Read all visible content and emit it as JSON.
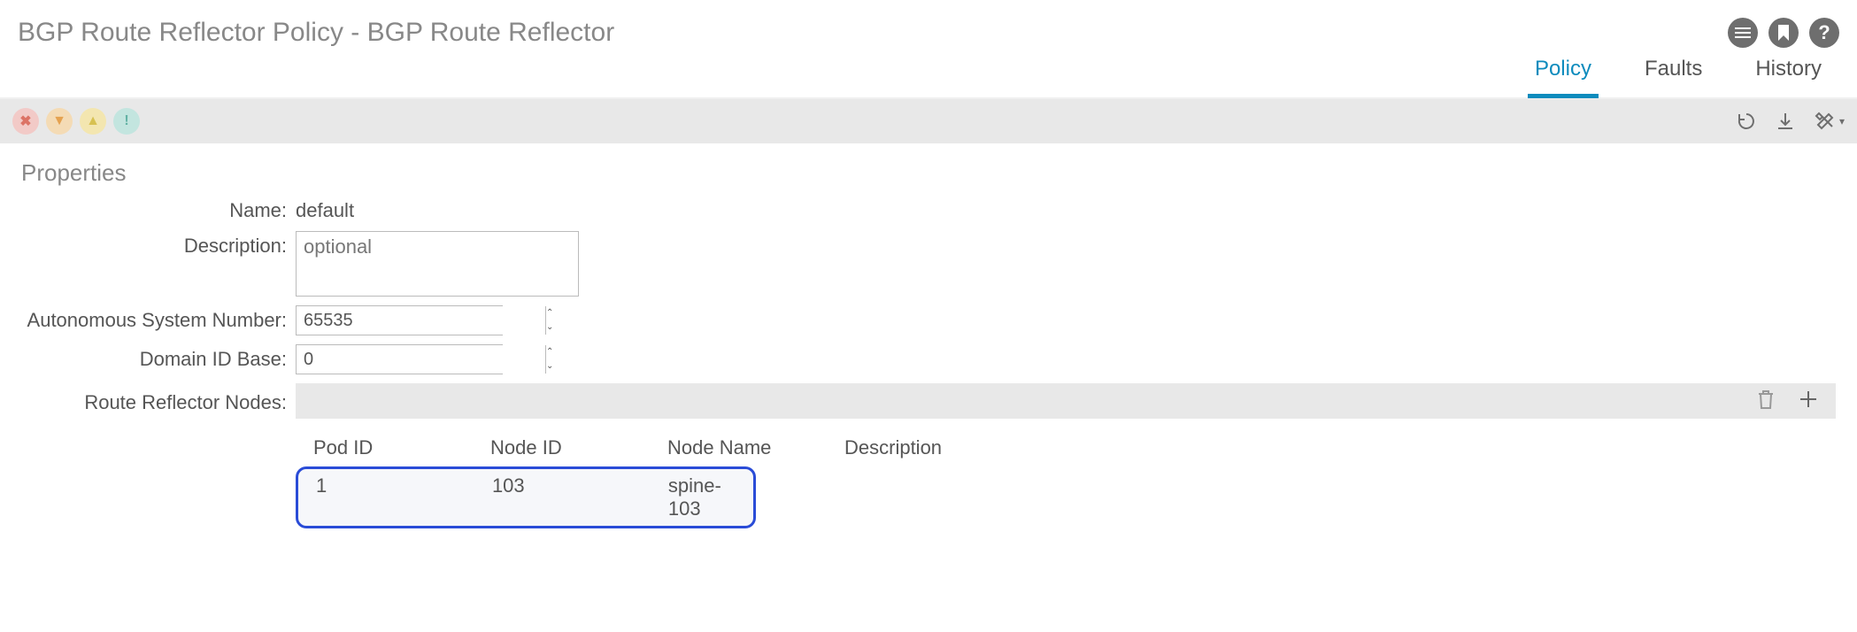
{
  "header": {
    "title": "BGP Route Reflector Policy - BGP Route Reflector",
    "icons": {
      "list": "list-icon",
      "bookmark": "bookmark-icon",
      "help": "help-icon"
    }
  },
  "tabs": [
    {
      "label": "Policy",
      "active": true
    },
    {
      "label": "Faults",
      "active": false
    },
    {
      "label": "History",
      "active": false
    }
  ],
  "status": {
    "critical": "✖",
    "major": "▼",
    "minor": "▲",
    "warning": "!"
  },
  "section": {
    "title": "Properties"
  },
  "form": {
    "name_label": "Name:",
    "name_value": "default",
    "description_label": "Description:",
    "description_value": "",
    "description_placeholder": "optional",
    "asn_label": "Autonomous System Number:",
    "asn_value": "65535",
    "domain_label": "Domain ID Base:",
    "domain_value": "0",
    "rr_label": "Route Reflector Nodes:"
  },
  "table": {
    "columns": {
      "pod": "Pod ID",
      "node": "Node ID",
      "name": "Node Name",
      "desc": "Description"
    },
    "rows": [
      {
        "pod": "1",
        "node": "103",
        "name": "spine-103",
        "desc": ""
      }
    ]
  }
}
